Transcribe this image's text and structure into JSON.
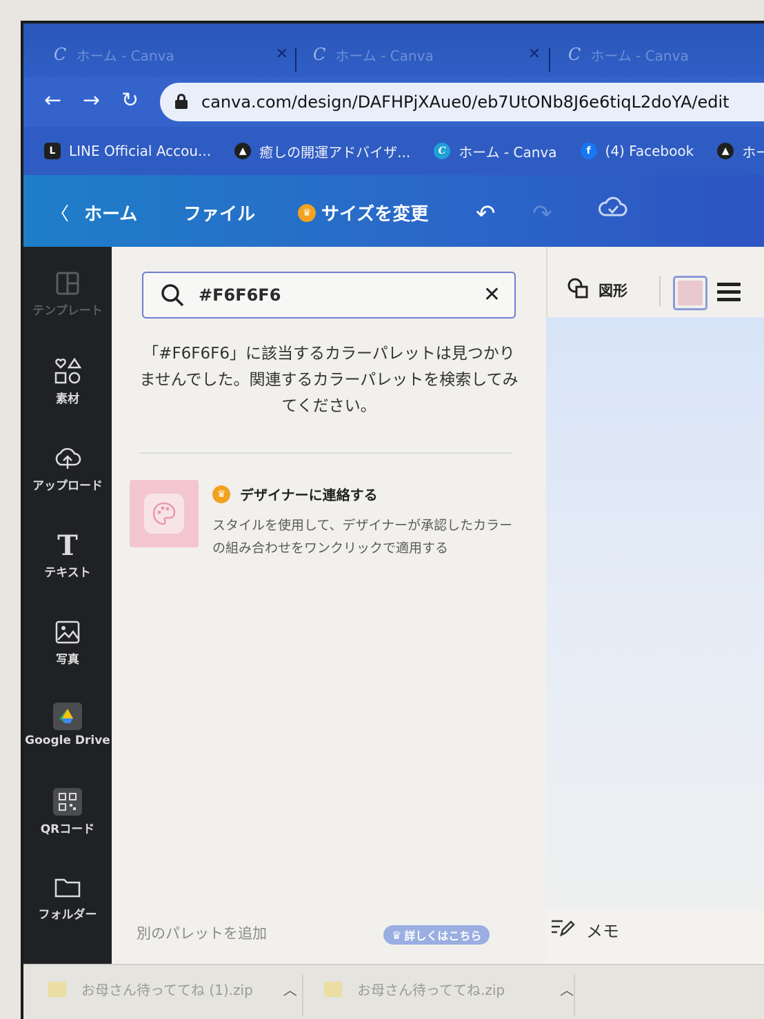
{
  "browser": {
    "tabs": [
      {
        "label": "ホーム - Canva",
        "close": "✕"
      },
      {
        "label": "ホーム - Canva",
        "close": "✕"
      },
      {
        "label": "ホーム - Canva"
      }
    ],
    "url": "canva.com/design/DAFHPjXAue0/eb7UtONb8J6e6tiqL2doYA/edit",
    "bookmarks": [
      {
        "label": "LINE Official Accou...",
        "icon": "line-icon",
        "color": "#1f1f1f"
      },
      {
        "label": "癒しの開運アドバイザ...",
        "icon": "cat-icon",
        "color": "#1f1f1f"
      },
      {
        "label": "ホーム - Canva",
        "icon": "canva-icon",
        "color": "#1fa0d6"
      },
      {
        "label": "(4) Facebook",
        "icon": "facebook-icon",
        "color": "#1877f2"
      },
      {
        "label": "ホーム | Ame",
        "icon": "cat-icon",
        "color": "#1f1f1f"
      }
    ]
  },
  "header": {
    "home": "ホーム",
    "file": "ファイル",
    "resize": "サイズを変更"
  },
  "sidebar": {
    "items": [
      {
        "label": "テンプレート",
        "icon": "template-icon"
      },
      {
        "label": "素材",
        "icon": "elements-icon"
      },
      {
        "label": "アップロード",
        "icon": "upload-cloud-icon"
      },
      {
        "label": "テキスト",
        "icon": "text-icon"
      },
      {
        "label": "写真",
        "icon": "photo-icon"
      },
      {
        "label": "Google Drive",
        "icon": "google-drive-icon"
      },
      {
        "label": "QRコード",
        "icon": "qr-code-icon"
      },
      {
        "label": "フォルダー",
        "icon": "folder-icon"
      }
    ]
  },
  "panel": {
    "search_value": "#F6F6F6",
    "not_found_message": "「#F6F6F6」に該当するカラーパレットは見つかりませんでした。関連するカラーパレットを検索してみてください。",
    "promo_title": "デザイナーに連絡する",
    "promo_desc": "スタイルを使用して、デザイナーが承認したカラーの組み合わせをワンクリックで適用する",
    "add_palette": "別のパレットを追加",
    "learn_more": "詳しくはこちら"
  },
  "toolbar": {
    "shapes": "図形",
    "swatch_color": "#eac8cf"
  },
  "memo": "メモ",
  "downloads": [
    {
      "label": "お母さん待っててね (1).zip"
    },
    {
      "label": "お母さん待っててね.zip"
    }
  ],
  "colors": {
    "canva_header_left": "#1e7ec8",
    "canva_header_right": "#2d54c2",
    "browser_blue": "#3463cc",
    "rail": "#1f2124",
    "crown": "#f2a21f"
  }
}
